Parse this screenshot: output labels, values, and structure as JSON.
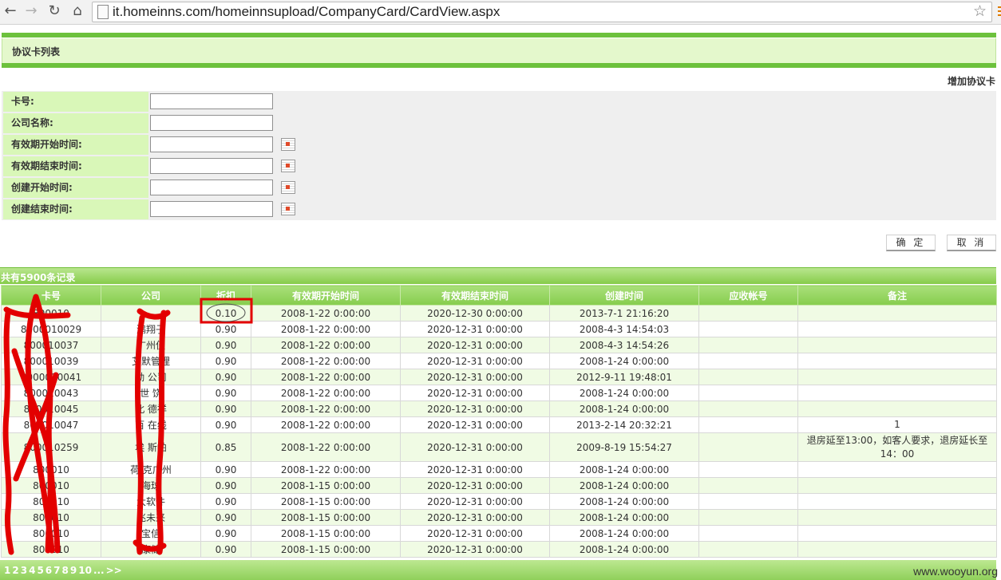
{
  "browser": {
    "back_icon": "arrow-left-icon",
    "forward_icon": "arrow-right-icon",
    "reload_icon": "reload-icon",
    "home_icon": "home-icon",
    "bookmark_icon": "star-icon",
    "url": "it.homeinns.com/homeinnsupload/CompanyCard/CardView.aspx"
  },
  "page": {
    "title": "协议卡列表",
    "add_link": "增加协议卡"
  },
  "search": {
    "fields": [
      {
        "label": "卡号:",
        "value": ""
      },
      {
        "label": "公司名称:",
        "value": ""
      },
      {
        "label": "有效期开始时间:",
        "value": ""
      },
      {
        "label": "有效期结束时间:",
        "value": ""
      },
      {
        "label": "创建开始时间:",
        "value": ""
      },
      {
        "label": "创建结束时间:",
        "value": ""
      }
    ],
    "confirm_button": "确 定",
    "cancel_button": "取 消"
  },
  "table": {
    "count_text": "共有5900条记录",
    "columns": [
      "卡号",
      "公司",
      "折扣",
      "有效期开始时间",
      "有效期结束时间",
      "创建时间",
      "应收帐号",
      "备注"
    ],
    "rows": [
      [
        "800010",
        "",
        "0.10",
        "2008-1-22 0:00:00",
        "2020-12-30 0:00:00",
        "2013-7-1 21:16:20",
        "",
        ""
      ],
      [
        "8000010029",
        "鸿翔子",
        "0.90",
        "2008-1-22 0:00:00",
        "2020-12-31 0:00:00",
        "2008-4-3 14:54:03",
        "",
        ""
      ],
      [
        "800010037",
        "广州伍",
        "0.90",
        "2008-1-22 0:00:00",
        "2020-12-31 0:00:00",
        "2008-4-3 14:54:26",
        "",
        ""
      ],
      [
        "800010039",
        "艾默管理",
        "0.90",
        "2008-1-22 0:00:00",
        "2020-12-31 0:00:00",
        "2008-1-24 0:00:00",
        "",
        ""
      ],
      [
        "8000010041",
        "劲 公司",
        "0.90",
        "2008-1-22 0:00:00",
        "2020-12-31 0:00:00",
        "2012-9-11 19:48:01",
        "",
        ""
      ],
      [
        "800010043",
        "世 饶",
        "0.90",
        "2008-1-22 0:00:00",
        "2020-12-31 0:00:00",
        "2008-1-24 0:00:00",
        "",
        ""
      ],
      [
        "800010045",
        "北 德祥",
        "0.90",
        "2008-1-22 0:00:00",
        "2020-12-31 0:00:00",
        "2008-1-24 0:00:00",
        "",
        ""
      ],
      [
        "800010047",
        "百 在线",
        "0.90",
        "2008-1-22 0:00:00",
        "2020-12-31 0:00:00",
        "2013-2-14 20:32:21",
        "",
        "1"
      ],
      [
        "800010259",
        "埃 斯帕",
        "0.85",
        "2008-1-22 0:00:00",
        "2020-12-31 0:00:00",
        "2009-8-19 15:54:27",
        "",
        "退房延至13:00，如客人要求，退房延长至14：00"
      ],
      [
        "800010",
        "荷 克广州",
        "0.90",
        "2008-1-22 0:00:00",
        "2020-12-31 0:00:00",
        "2008-1-24 0:00:00",
        "",
        ""
      ],
      [
        "800010",
        "海球",
        "0.90",
        "2008-1-15 0:00:00",
        "2020-12-31 0:00:00",
        "2008-1-24 0:00:00",
        "",
        ""
      ],
      [
        "800010",
        "大软件",
        "0.90",
        "2008-1-15 0:00:00",
        "2020-12-31 0:00:00",
        "2008-1-24 0:00:00",
        "",
        ""
      ],
      [
        "800010",
        "兆未来",
        "0.90",
        "2008-1-15 0:00:00",
        "2020-12-31 0:00:00",
        "2008-1-24 0:00:00",
        "",
        ""
      ],
      [
        "800010",
        "宝信",
        "0.90",
        "2008-1-15 0:00:00",
        "2020-12-31 0:00:00",
        "2008-1-24 0:00:00",
        "",
        ""
      ],
      [
        "800010",
        "康储",
        "0.90",
        "2008-1-15 0:00:00",
        "2020-12-31 0:00:00",
        "2008-1-24 0:00:00",
        "",
        ""
      ]
    ]
  },
  "pager": {
    "pages": [
      "1",
      "2",
      "3",
      "4",
      "5",
      "6",
      "7",
      "8",
      "9",
      "10",
      "...",
      ">>"
    ]
  },
  "watermark": "www.wooyun.org",
  "colors": {
    "accent_green": "#6cc13c",
    "header_green": "#86cd4d",
    "label_bg": "#d9f7b8",
    "annotation_red": "#e30000"
  }
}
